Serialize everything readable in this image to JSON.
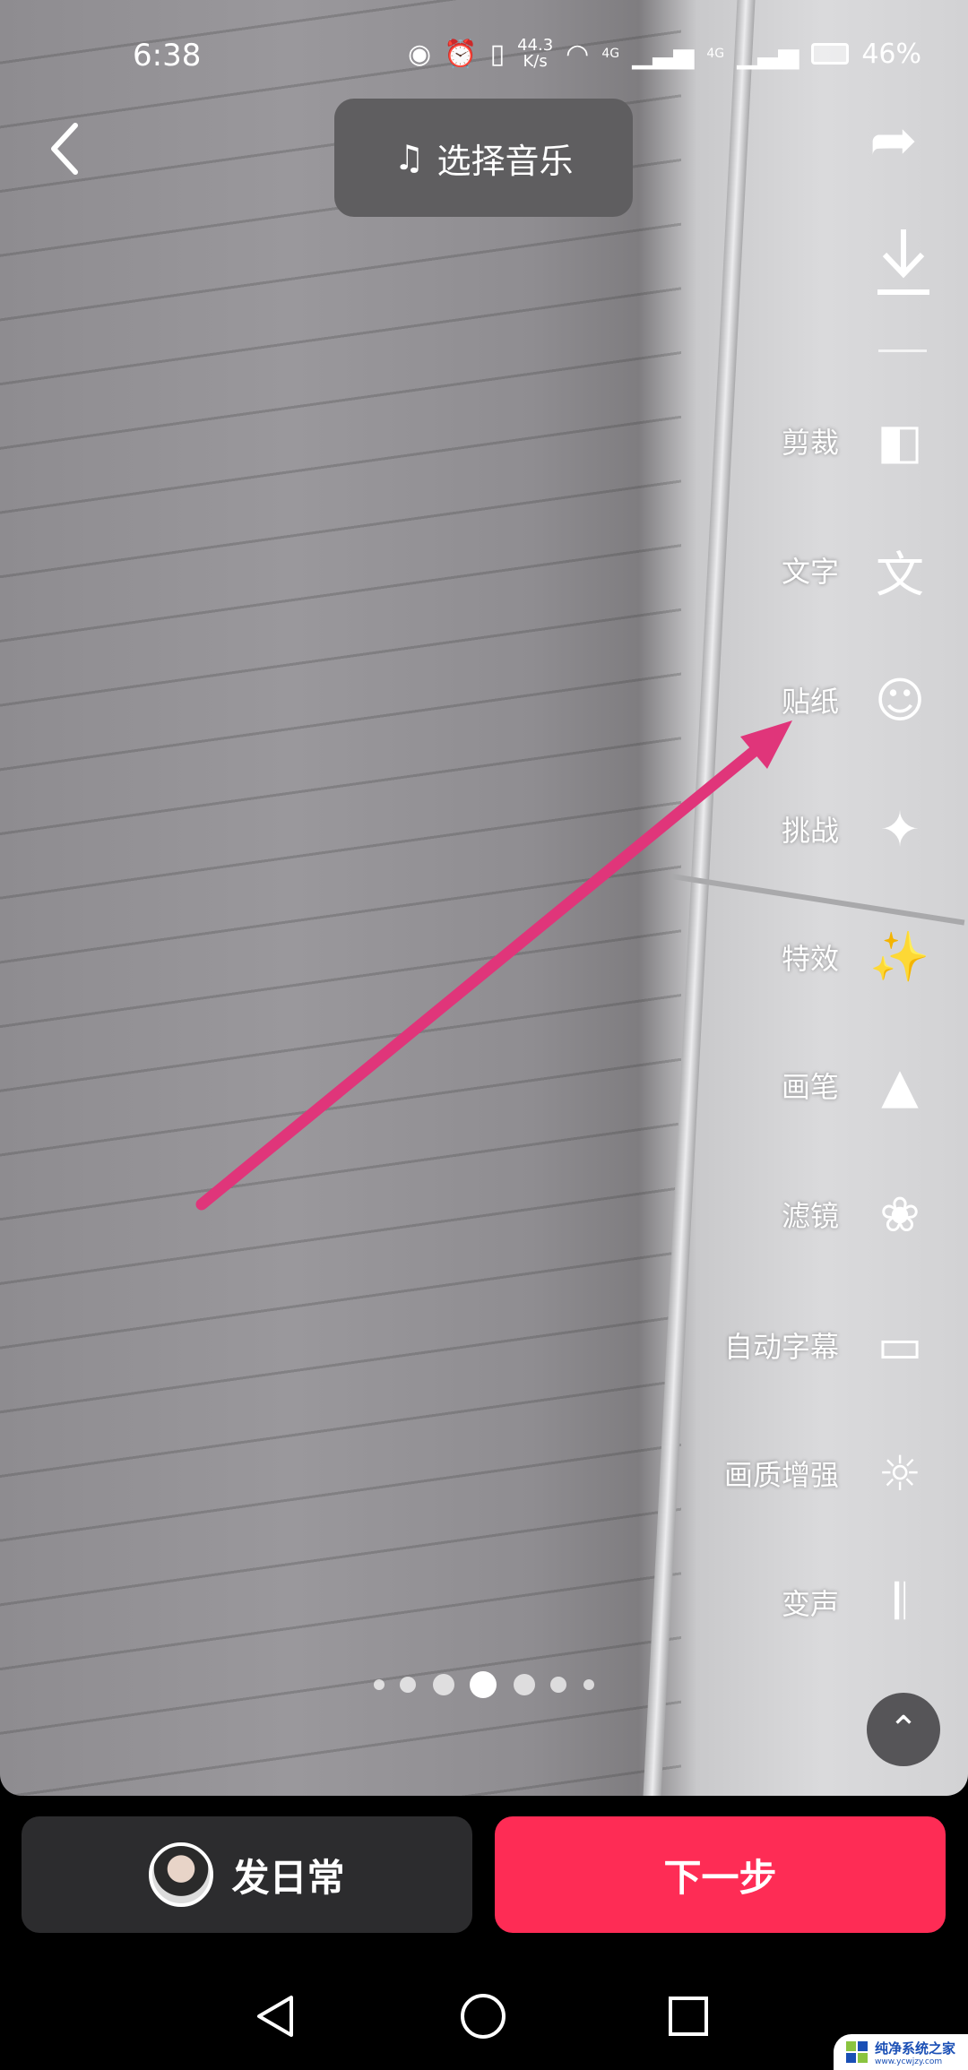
{
  "status_bar": {
    "time": "6:38",
    "net_speed": "44.3",
    "net_unit": "K/s",
    "battery": "46%",
    "signal1": "4G",
    "signal2": "4G"
  },
  "top": {
    "music_label": "选择音乐"
  },
  "tools": [
    {
      "label": "剪裁",
      "icon": "crop-icon"
    },
    {
      "label": "文字",
      "icon": "text-icon"
    },
    {
      "label": "贴纸",
      "icon": "sticker-icon"
    },
    {
      "label": "挑战",
      "icon": "challenge-icon"
    },
    {
      "label": "特效",
      "icon": "effects-sparkle-icon"
    },
    {
      "label": "画笔",
      "icon": "brush-icon"
    },
    {
      "label": "滤镜",
      "icon": "filter-icon"
    },
    {
      "label": "自动字幕",
      "icon": "auto-caption-icon"
    },
    {
      "label": "画质增强",
      "icon": "enhance-off-icon"
    },
    {
      "label": "变声",
      "icon": "voice-change-icon"
    }
  ],
  "page_dots": {
    "count": 7,
    "active": 4
  },
  "bottom": {
    "daily_label": "发日常",
    "next_label": "下一步"
  },
  "annotation": {
    "arrow_color": "#e0357a",
    "target": "贴纸"
  },
  "colors": {
    "next_button": "#fe2c55",
    "daily_button": "#2c2c2e"
  },
  "watermark": {
    "title": "纯净系统之家",
    "url": "www.ycwjzy.com"
  }
}
